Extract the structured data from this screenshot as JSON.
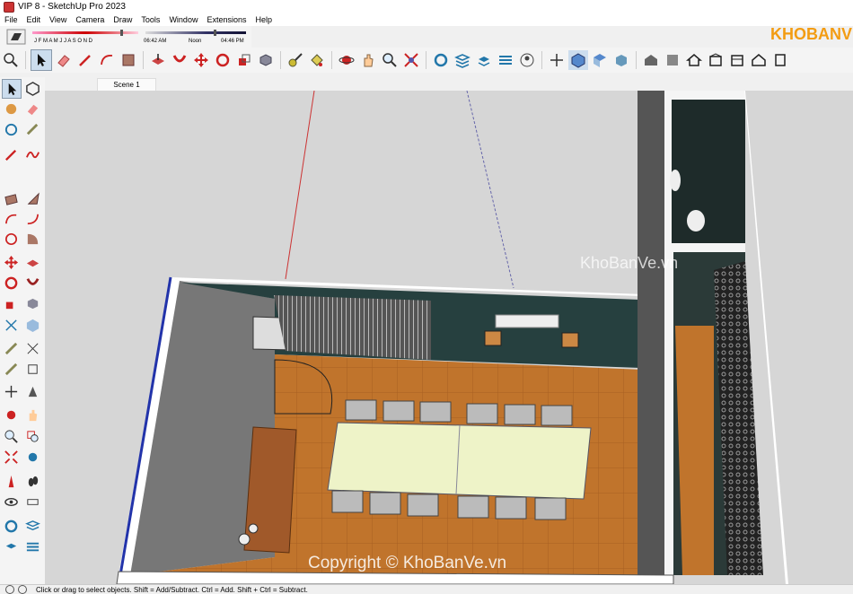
{
  "window": {
    "title": "VIP 8 - SketchUp Pro 2023"
  },
  "menu": [
    "File",
    "Edit",
    "View",
    "Camera",
    "Draw",
    "Tools",
    "Window",
    "Extensions",
    "Help"
  ],
  "shadow": {
    "months": "J F M A M J J A S O N D",
    "time_start": "06:42 AM",
    "time_mid": "Noon",
    "time_end": "04:46 PM"
  },
  "scene_tab": "Scene 1",
  "status_text": "Click or drag to select objects. Shift = Add/Subtract. Ctrl = Add. Shift + Ctrl = Subtract.",
  "watermarks": {
    "logo": "KHOBANVE",
    "center": "KhoBanVe.vn",
    "bottom": "Copyright © KhoBanVe.vn"
  },
  "toolbar_icons": [
    "zoom-extents-icon",
    "select-icon",
    "eraser-icon",
    "pencil-icon",
    "arc-icon",
    "paint-bucket-icon",
    "push-pull-icon",
    "follow-me-icon",
    "move-icon",
    "rotate-icon",
    "scale-icon",
    "offset-icon",
    "tape-measure-icon",
    "paint-icon",
    "orbit-icon",
    "pan-icon",
    "zoom-icon",
    "zoom-window-icon",
    "section-icon",
    "layer-icon",
    "outliner-icon",
    "styles-icon",
    "account-icon",
    "axes-icon",
    "iso-view-icon",
    "top-view-icon",
    "front-view-icon",
    "warehouse-icon",
    "extension-icon",
    "home-icon",
    "building-icon",
    "house-icon",
    "house-outline-icon",
    "square-icon"
  ]
}
